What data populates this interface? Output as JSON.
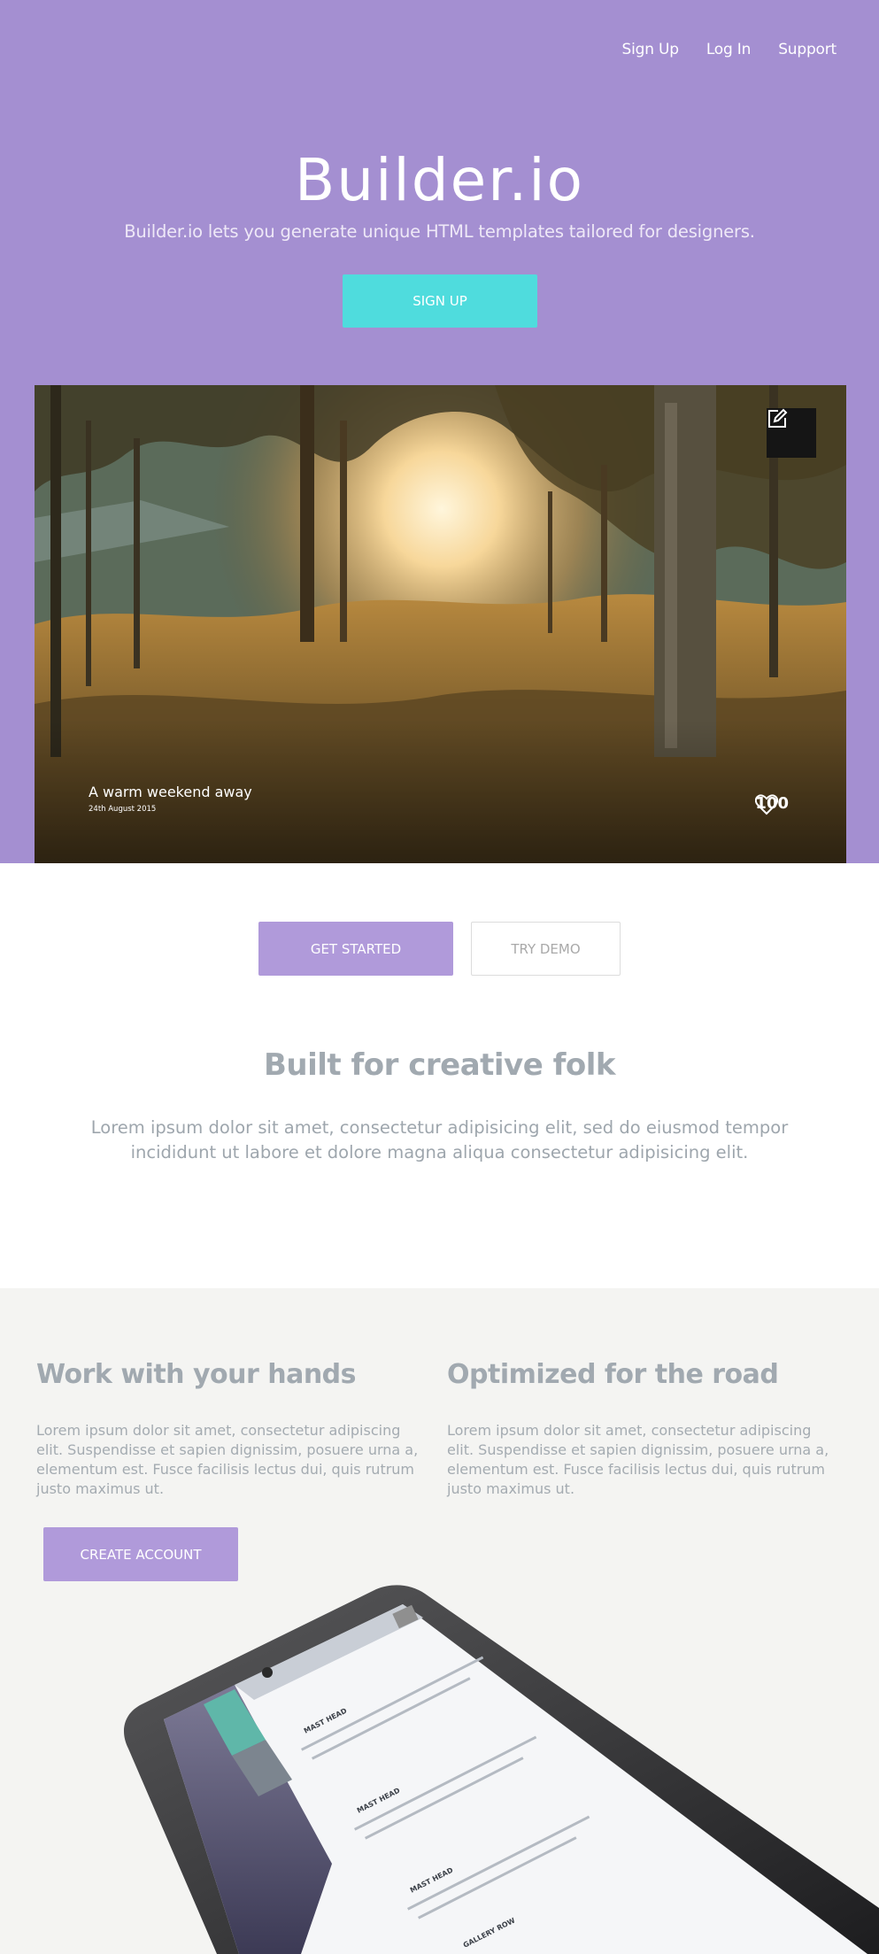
{
  "nav": {
    "items": [
      "Sign Up",
      "Log In",
      "Support"
    ]
  },
  "hero": {
    "title": "Builder.io",
    "subtitle": "Builder.io lets you generate unique HTML templates tailored for designers.",
    "cta": "SIGN UP"
  },
  "photo_card": {
    "title": "A warm weekend away",
    "date": "24th August 2015",
    "likes": "100",
    "icons": {
      "edit": "edit-icon",
      "like": "heart-icon"
    }
  },
  "actions": {
    "primary": "GET STARTED",
    "secondary": "TRY DEMO"
  },
  "intro": {
    "title": "Built for creative folk",
    "body": "Lorem ipsum dolor sit amet, consectetur adipisicing elit, sed do eiusmod tempor incididunt ut labore et dolore magna aliqua consectetur adipisicing elit."
  },
  "features": [
    {
      "title": "Work with your hands",
      "body": "Lorem ipsum dolor sit amet, consectetur adipiscing elit. Suspendisse et sapien dignissim, posuere urna a, elementum est. Fusce facilisis lectus dui, quis rutrum justo maximus ut."
    },
    {
      "title": "Optimized for the road",
      "body": "Lorem ipsum dolor sit amet, consectetur adipiscing elit. Suspendisse et sapien dignissim, posuere urna a, elementum est. Fusce facilisis lectus dui, quis rutrum justo maximus ut."
    }
  ],
  "create_account": "CREATE ACCOUNT",
  "phone_screen": {
    "rows": [
      "MAST HEAD",
      "MAST HEAD",
      "MAST HEAD",
      "GALLERY ROW"
    ]
  },
  "colors": {
    "hero_bg": "#a48fd1",
    "accent_cyan": "#4fdcdd",
    "primary_button": "#b09ada",
    "heading_grey": "#a1a9b0",
    "section_bg": "#f4f4f2"
  }
}
